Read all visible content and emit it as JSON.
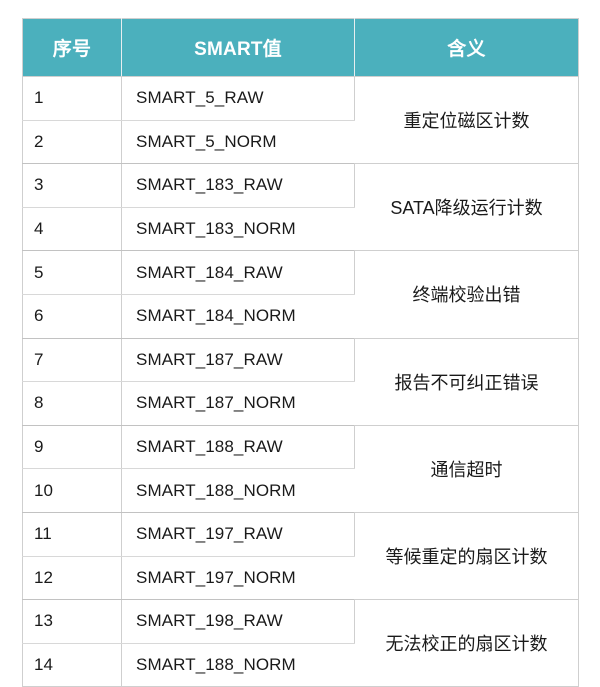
{
  "table": {
    "columns": [
      {
        "key": "index",
        "label": "序号"
      },
      {
        "key": "smart",
        "label": "SMART值"
      },
      {
        "key": "meaning",
        "label": "含义"
      }
    ],
    "header_bg": "#4BB0BD",
    "header_fg": "#FFFFFF",
    "border_color": "#CFCFCF",
    "groups": [
      {
        "meaning": "重定位磁区计数",
        "rows": [
          {
            "index": "1",
            "smart": "SMART_5_RAW"
          },
          {
            "index": "2",
            "smart": "SMART_5_NORM"
          }
        ]
      },
      {
        "meaning": "SATA降级运行计数",
        "rows": [
          {
            "index": "3",
            "smart": "SMART_183_RAW"
          },
          {
            "index": "4",
            "smart": "SMART_183_NORM"
          }
        ]
      },
      {
        "meaning": "终端校验出错",
        "rows": [
          {
            "index": "5",
            "smart": "SMART_184_RAW"
          },
          {
            "index": "6",
            "smart": "SMART_184_NORM"
          }
        ]
      },
      {
        "meaning": "报告不可纠正错误",
        "rows": [
          {
            "index": "7",
            "smart": "SMART_187_RAW"
          },
          {
            "index": "8",
            "smart": "SMART_187_NORM"
          }
        ]
      },
      {
        "meaning": "通信超时",
        "rows": [
          {
            "index": "9",
            "smart": "SMART_188_RAW"
          },
          {
            "index": "10",
            "smart": "SMART_188_NORM"
          }
        ]
      },
      {
        "meaning": "等候重定的扇区计数",
        "rows": [
          {
            "index": "11",
            "smart": "SMART_197_RAW"
          },
          {
            "index": "12",
            "smart": "SMART_197_NORM"
          }
        ]
      },
      {
        "meaning": "无法校正的扇区计数",
        "rows": [
          {
            "index": "13",
            "smart": "SMART_198_RAW"
          },
          {
            "index": "14",
            "smart": "SMART_188_NORM"
          }
        ]
      }
    ]
  }
}
